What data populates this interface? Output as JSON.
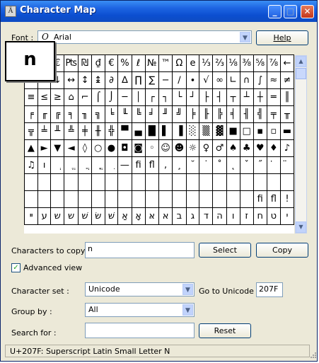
{
  "window": {
    "title": "Character Map",
    "controls": {
      "minimize": "_",
      "maximize": "□",
      "close": "✕"
    }
  },
  "font": {
    "label": "Font",
    "value": "Arial",
    "font_icon": "O"
  },
  "help_button": "Help",
  "zoom_char": "n",
  "grid": {
    "rows": [
      [
        "¤",
        "¢",
        "€",
        "₧",
        "₪",
        "₫",
        "€",
        "%",
        "ℓ",
        "№",
        "™",
        "Ω",
        "e",
        "⅓",
        "⅔",
        "⅛",
        "⅜",
        "⅝",
        "⅞",
        "←"
      ],
      [
        "↑",
        "→",
        "↓",
        "↔",
        "↕",
        "↨",
        "∂",
        "∆",
        "∏",
        "∑",
        "−",
        "∕",
        "∙",
        "√",
        "∞",
        "∟",
        "∩",
        "∫",
        "≈",
        "≠"
      ],
      [
        "≡",
        "≤",
        "≥",
        "⌂",
        "⌐",
        "⌠",
        "⌡",
        "─",
        "│",
        "┌",
        "┐",
        "└",
        "┘",
        "├",
        "┤",
        "┬",
        "┴",
        "┼",
        "═",
        "║"
      ],
      [
        "╒",
        "╓",
        "╔",
        "╕",
        "╖",
        "╗",
        "╘",
        "╙",
        "╚",
        "╛",
        "╜",
        "╝",
        "╞",
        "╟",
        "╠",
        "╡",
        "╢",
        "╣",
        "╤",
        "╥"
      ],
      [
        "╦",
        "╧",
        "╨",
        "╩",
        "╪",
        "╫",
        "╬",
        "▀",
        "▄",
        "█",
        "▌",
        "▐",
        "░",
        "▒",
        "▓",
        "■",
        "□",
        "▪",
        "▫",
        "▬"
      ],
      [
        "▲",
        "►",
        "▼",
        "◄",
        "◊",
        "○",
        "●",
        "◘",
        "◙",
        "◦",
        "☺",
        "☻",
        "☼",
        "♀",
        "♂",
        "♠",
        "♣",
        "♥",
        "♦",
        "♪"
      ],
      [
        "♫",
        "ו",
        "ְ",
        "ֱ",
        "ֲ",
        "ֳ",
        "ִ",
        "—",
        "ﬁ",
        "ﬂ",
        ",",
        "¸",
        "˘",
        "˙",
        "˚",
        "˛",
        "ˇ",
        "˝",
        "̇",
        "̈"
      ],
      [
        "",
        "",
        "",
        "",
        "",
        "",
        "",
        "",
        "",
        "",
        "",
        "",
        "",
        "",
        "",
        "",
        "",
        "",
        "",
        ""
      ],
      [
        "",
        "",
        "",
        "",
        "",
        "",
        "",
        "",
        "",
        "",
        "",
        "",
        "",
        "",
        "",
        "",
        "",
        "ﬁ",
        "ﬂ",
        "!"
      ],
      [
        "ײ",
        "ע",
        "ש",
        "ש",
        "שׁ",
        "שׂ",
        "שּׁ",
        "אַ",
        "אָ",
        "אּ",
        "א",
        "ב",
        "ג",
        "ד",
        "ה",
        "ו",
        "ז",
        "ח",
        "ט",
        "י"
      ]
    ]
  },
  "chars_to_copy": {
    "label": "Characters to copy :",
    "value": "n"
  },
  "select_button": "Select",
  "copy_button": "Copy",
  "advanced_view": {
    "label": "Advanced view",
    "checked": true,
    "check_mark": "✓"
  },
  "character_set": {
    "label": "Character set :",
    "value": "Unicode"
  },
  "goto_unicode": {
    "label": "Go to Unicode :",
    "value": "207F"
  },
  "group_by": {
    "label": "Group by :",
    "value": "All"
  },
  "search_for": {
    "label": "Search for :",
    "value": ""
  },
  "reset_button": "Reset",
  "status_text": "U+207F: Superscript Latin Small Letter N"
}
